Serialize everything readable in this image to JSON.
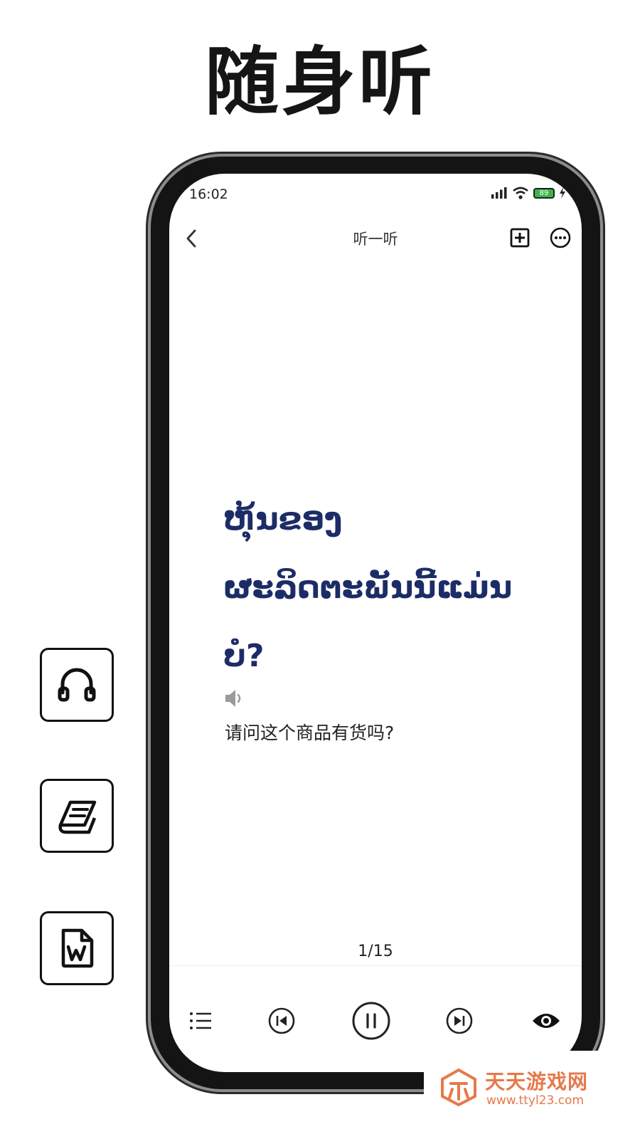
{
  "headline": "随身听",
  "feature_tiles": [
    {
      "icon": "headphones-icon"
    },
    {
      "icon": "book-icon"
    },
    {
      "icon": "word-document-icon"
    }
  ],
  "status_bar": {
    "time": "16:02",
    "battery_level": "89",
    "icons": [
      "signal-icon",
      "wifi-icon",
      "battery-icon",
      "charging-icon"
    ]
  },
  "nav": {
    "title": "听一听",
    "back_icon": "chevron-left-icon",
    "add_icon": "plus-square-icon",
    "more_icon": "more-horizontal-icon"
  },
  "card": {
    "lao_lines": [
      "ຫຸ້ນຂອງ",
      "ຜະລິດຕະພັນນີ້ແມ່ນ",
      "ບໍ?"
    ],
    "translation": "请问这个商品有货吗?"
  },
  "pager": {
    "current": 1,
    "total": 15,
    "label": "1/15"
  },
  "controls": [
    "list-icon",
    "previous-icon",
    "pause-icon",
    "next-icon",
    "eye-icon"
  ],
  "colors": {
    "lao_text": "#1c2c66",
    "battery": "#3bb54a",
    "watermark": "#e8784a"
  },
  "watermark": {
    "name": "天天游戏网",
    "url": "www.ttyl23.com"
  }
}
